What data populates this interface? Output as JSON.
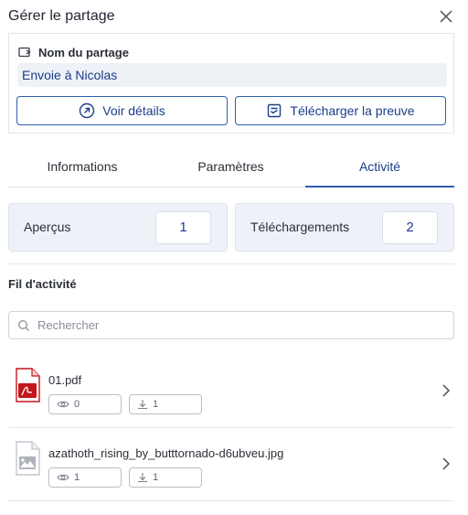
{
  "header": {
    "title": "Gérer le partage"
  },
  "share": {
    "label": "Nom du partage",
    "name": "Envoie à Nicolas",
    "details_button": "Voir détails",
    "proof_button": "Télécharger la preuve"
  },
  "tabs": [
    {
      "label": "Informations",
      "active": false
    },
    {
      "label": "Paramètres",
      "active": false
    },
    {
      "label": "Activité",
      "active": true
    }
  ],
  "stats": {
    "views_label": "Aperçus",
    "views_value": "1",
    "downloads_label": "Téléchargements",
    "downloads_value": "2"
  },
  "feed": {
    "title": "Fil d'activité",
    "search_placeholder": "Rechercher",
    "files": [
      {
        "name": "01.pdf",
        "views": "0",
        "downloads": "1",
        "icon": "pdf-file-icon"
      },
      {
        "name": "azathoth_rising_by_butttornado-d6ubveu.jpg",
        "views": "1",
        "downloads": "1",
        "icon": "image-file-icon"
      }
    ]
  },
  "colors": {
    "accent": "#2f5fb0",
    "accent_text": "#1b3d8a",
    "pdf_red": "#c4161c",
    "stat_bg": "#eef2f8"
  }
}
